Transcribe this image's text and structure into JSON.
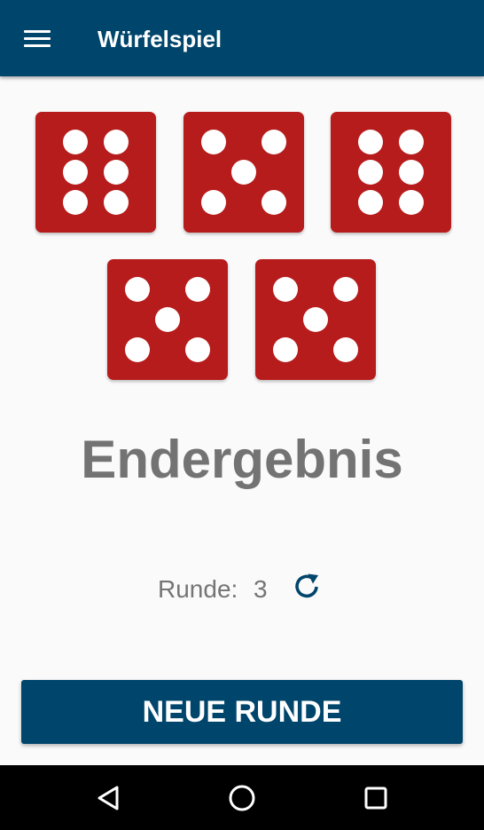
{
  "app_bar": {
    "title": "Würfelspiel",
    "menu_icon": "menu-icon",
    "background": "#00456b"
  },
  "dice": [
    {
      "value": 6,
      "color": "#b71c1c"
    },
    {
      "value": 5,
      "color": "#b71c1c"
    },
    {
      "value": 6,
      "color": "#b71c1c"
    },
    {
      "value": 5,
      "color": "#b71c1c"
    },
    {
      "value": 5,
      "color": "#b71c1c"
    }
  ],
  "result": {
    "title": "Endergebnis"
  },
  "round": {
    "label": "Runde:",
    "value": "3",
    "reset_icon": "refresh-icon"
  },
  "button": {
    "new_round_label": "NEUE RUNDE"
  },
  "nav_bar": {
    "back_icon": "back-triangle-icon",
    "home_icon": "home-circle-icon",
    "recents_icon": "recents-square-icon"
  }
}
